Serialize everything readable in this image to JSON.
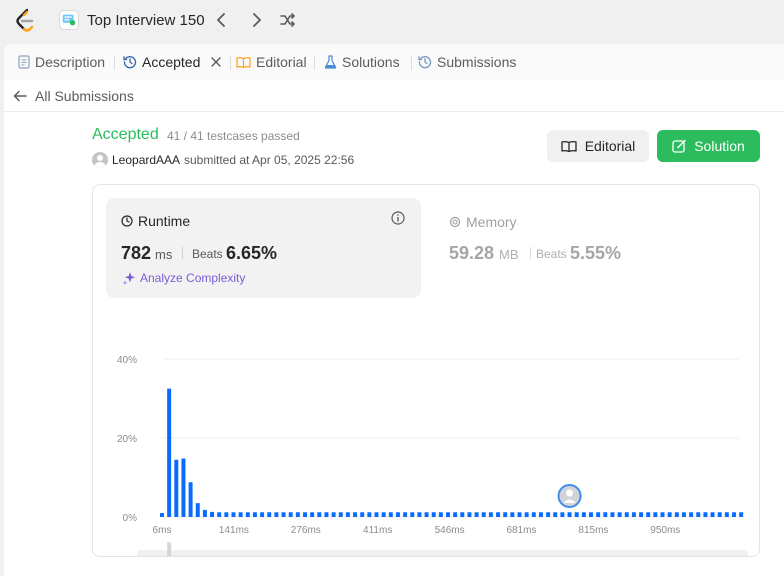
{
  "topbar": {
    "workspace_title": "Top Interview 150",
    "icons": [
      "leetcode-logo-icon",
      "study-plan-icon",
      "chevron-left-icon",
      "chevron-right-icon",
      "shuffle-icon"
    ]
  },
  "tabs": [
    {
      "label": "Description",
      "icon": "file-icon",
      "active": false
    },
    {
      "label": "Accepted",
      "icon": "history-icon",
      "active": true,
      "closable": true
    },
    {
      "label": "Editorial",
      "icon": "book-icon",
      "active": false
    },
    {
      "label": "Solutions",
      "icon": "flask-icon",
      "active": false
    },
    {
      "label": "Submissions",
      "icon": "history-icon",
      "active": false
    }
  ],
  "subbar": {
    "back_label": "All Submissions"
  },
  "result": {
    "status": "Accepted",
    "testcases": "41 / 41 testcases passed",
    "user": "LeopardAAA",
    "submitted": "submitted at Apr 05, 2025 22:56"
  },
  "buttons": {
    "editorial": "Editorial",
    "solution": "Solution"
  },
  "runtime": {
    "title": "Runtime",
    "value": "782",
    "unit": "ms",
    "beats_label": "Beats",
    "beats_value": "6.65%",
    "analyze_label": "Analyze Complexity"
  },
  "memory": {
    "title": "Memory",
    "value": "59.28",
    "unit": "MB",
    "beats_label": "Beats",
    "beats_value": "5.55%"
  },
  "colors": {
    "accepted": "#2cbb5d",
    "bar": "#0a6cff",
    "analyze": "#7c5cd6"
  },
  "chart_data": {
    "type": "bar",
    "y_ticks": [
      "40%",
      "20%",
      "0%"
    ],
    "ylim": [
      0,
      40
    ],
    "x_tick_labels": [
      "6ms",
      "141ms",
      "276ms",
      "411ms",
      "546ms",
      "681ms",
      "815ms",
      "950ms"
    ],
    "values": [
      1,
      32.5,
      14.5,
      14.8,
      8.8,
      3.5,
      1.8,
      1.3,
      1.2,
      1.2,
      1.2,
      1.2,
      1.2,
      1.2,
      1.2,
      1.2,
      1.2,
      1.2,
      1.2,
      1.2,
      1.2,
      1.2,
      1.2,
      1.2,
      1.2,
      1.2,
      1.2,
      1.2,
      1.2,
      1.2,
      1.2,
      1.2,
      1.2,
      1.2,
      1.2,
      1.2,
      1.2,
      1.2,
      1.2,
      1.2,
      1.2,
      1.2,
      1.2,
      1.2,
      1.2,
      1.2,
      1.2,
      1.2,
      1.2,
      1.2,
      1.2,
      1.2,
      1.2,
      1.2,
      1.2,
      1.2,
      1.2,
      1.2,
      1.2,
      1.2,
      1.2,
      1.2,
      1.2,
      1.2,
      1.2,
      1.2,
      1.2,
      1.2,
      1.2,
      1.2,
      1.2,
      1.2,
      1.2,
      1.2,
      1.2,
      1.2,
      1.2,
      1.2,
      1.2,
      1.2,
      1.2,
      1.2
    ],
    "user_bar_index": 57
  }
}
